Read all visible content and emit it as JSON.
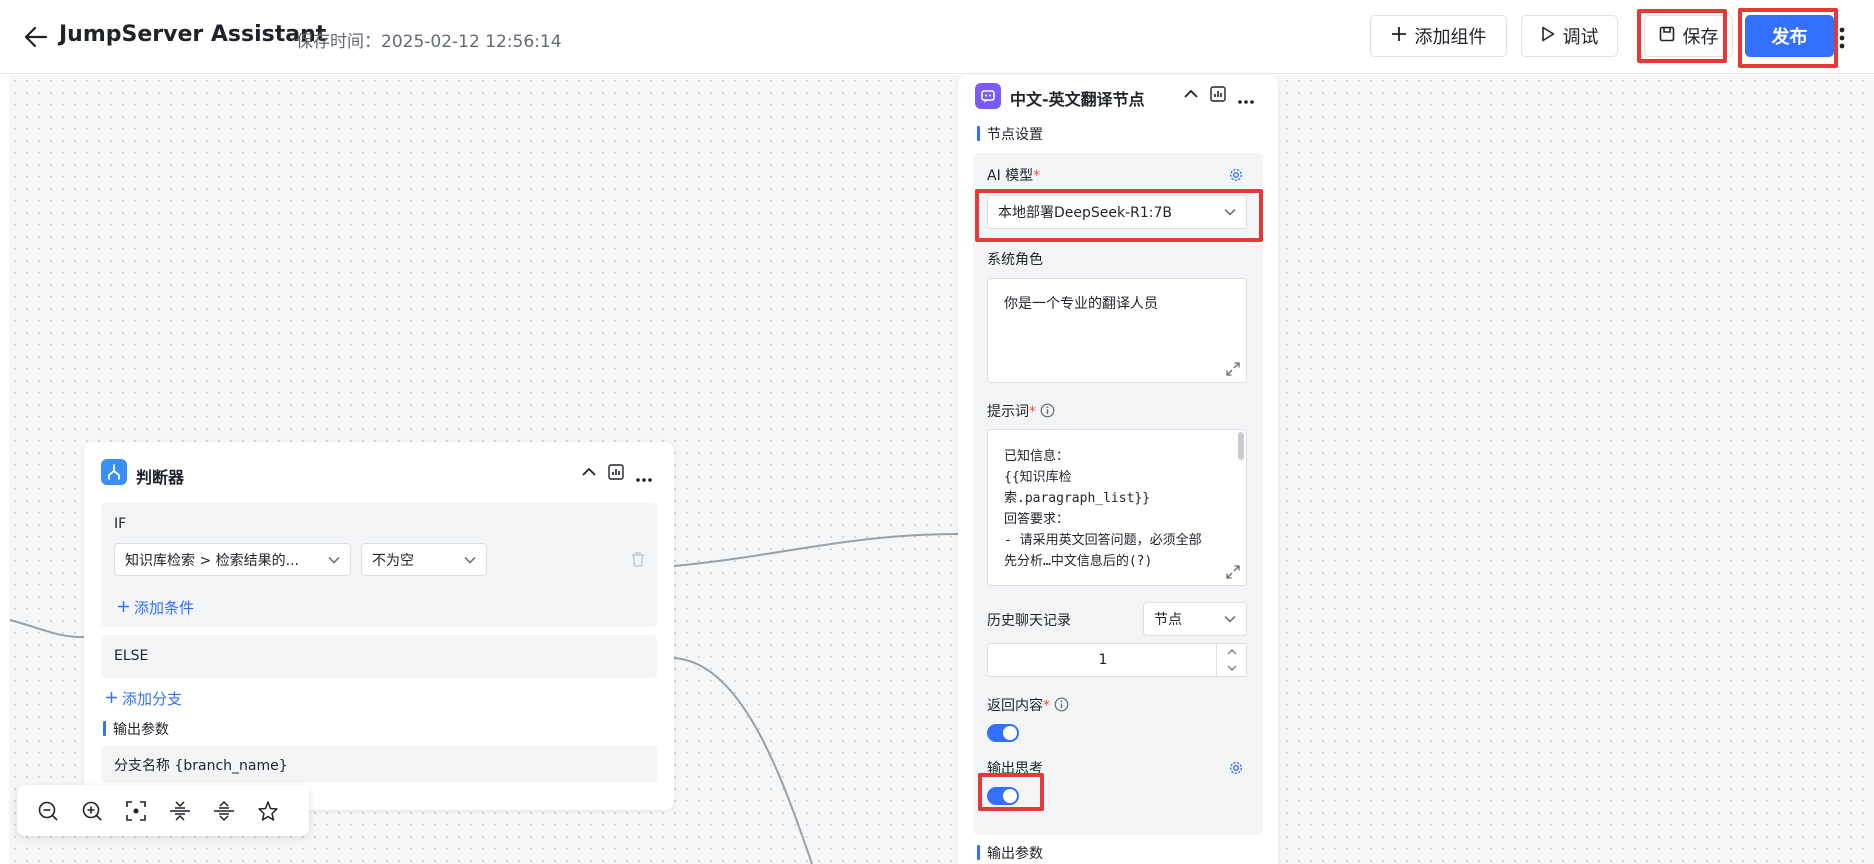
{
  "header": {
    "title": "JumpServer Assistant",
    "save_time": "保存时间：2025-02-12 12:56:14",
    "add_component": "添加组件",
    "debug": "调试",
    "save": "保存",
    "publish": "发布"
  },
  "judge_node": {
    "title": "判断器",
    "if_label": "IF",
    "condition_field": "知识库检索 > 检索结果的...",
    "condition_op": "不为空",
    "add_condition": "添加条件",
    "else_label": "ELSE",
    "add_branch": "添加分支",
    "output_label": "输出参数",
    "output_param": "分支名称 {branch_name}"
  },
  "translate_node": {
    "title": "中文-英文翻译节点",
    "section_label": "节点设置",
    "ai_model_label": "AI 模型",
    "ai_model_value": "本地部署DeepSeek-R1:7B",
    "system_role_label": "系统角色",
    "system_role_value": "你是一个专业的翻译人员",
    "prompt_label": "提示词",
    "prompt_lines": [
      "已知信息：",
      "{{知识库检",
      "索.paragraph_list}}",
      "回答要求：",
      "- 请采用英文回答问题，必须全部",
      "先分析…中文信息后的(?)"
    ],
    "history_label": "历史聊天记录",
    "history_scope": "节点",
    "history_count": "1",
    "return_content_label": "返回内容",
    "return_content_enabled": true,
    "output_thinking_label": "输出思考",
    "output_thinking_enabled": true,
    "output_params_label": "输出参数"
  },
  "colors": {
    "accent": "#3370ff",
    "highlight_box": "#e53935",
    "judge_icon_bg": "#3a8ff7",
    "translate_icon_bg": "#7a5af8"
  },
  "icons": [
    "back-arrow-icon",
    "plus-icon",
    "play-icon",
    "save-icon",
    "more-vertical-icon",
    "branch-icon",
    "chat-bot-icon",
    "chevron-up-icon",
    "chart-icon",
    "more-horizontal-icon",
    "trash-icon",
    "chevron-down-icon",
    "gear-icon",
    "info-icon",
    "expand-icon",
    "zoom-out-icon",
    "zoom-in-icon",
    "fit-view-icon",
    "collapse-icon",
    "expand-nodes-icon",
    "beautify-icon"
  ]
}
